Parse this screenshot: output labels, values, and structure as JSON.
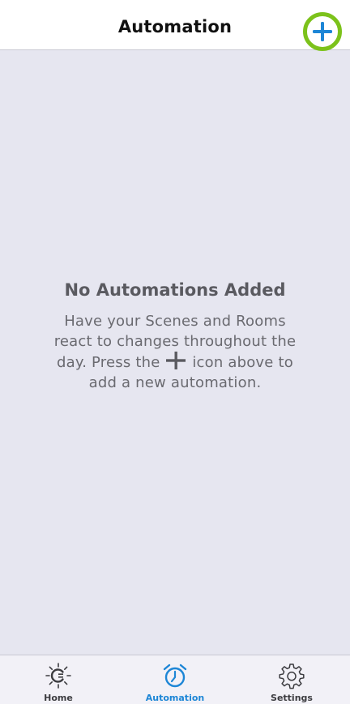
{
  "header": {
    "title": "Automation",
    "add_icon": "plus-icon"
  },
  "empty_state": {
    "title": "No Automations Added",
    "text_before_icon": "Have your Scenes and Rooms react to changes throughout the day. Press the",
    "text_after_icon": "icon above to add a new automation.",
    "inline_icon": "plus-icon"
  },
  "tabbar": {
    "tabs": [
      {
        "label": "Home",
        "icon": "sun-icon",
        "active": false
      },
      {
        "label": "Automation",
        "icon": "alarm-clock-icon",
        "active": true
      },
      {
        "label": "Settings",
        "icon": "gear-icon",
        "active": false
      }
    ]
  },
  "colors": {
    "accent_blue": "#1d86d6",
    "highlight_green": "#7cc21b",
    "background": "#e6e6f0"
  }
}
